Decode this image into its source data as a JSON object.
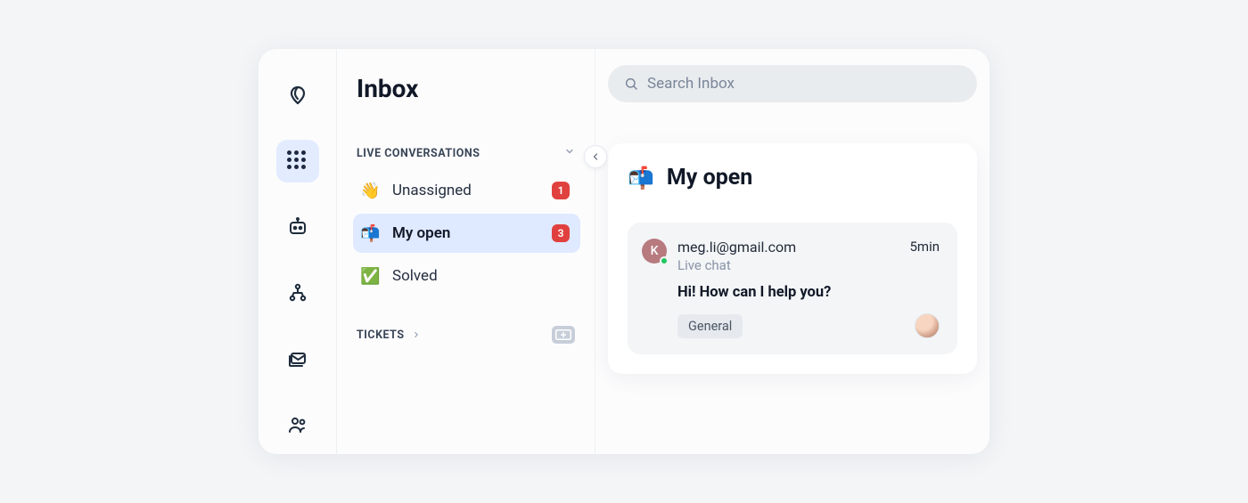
{
  "sidebar": {
    "title": "Inbox",
    "sections": {
      "conversations": {
        "label": "LIVE CONVERSATIONS",
        "items": [
          {
            "emoji": "👋",
            "label": "Unassigned",
            "badge": "1",
            "active": false
          },
          {
            "emoji": "📬",
            "label": "My open",
            "badge": "3",
            "active": true
          },
          {
            "emoji": "✅",
            "label": "Solved",
            "badge": null,
            "active": false
          }
        ]
      },
      "tickets": {
        "label": "TICKETS"
      }
    }
  },
  "search": {
    "placeholder": "Search Inbox"
  },
  "panel": {
    "emoji": "📬",
    "title": "My open"
  },
  "conversation": {
    "avatar_initial": "K",
    "sender": "meg.li@gmail.com",
    "channel": "Live chat",
    "time": "5min",
    "preview": "Hi! How can I help you?",
    "tag": "General"
  }
}
